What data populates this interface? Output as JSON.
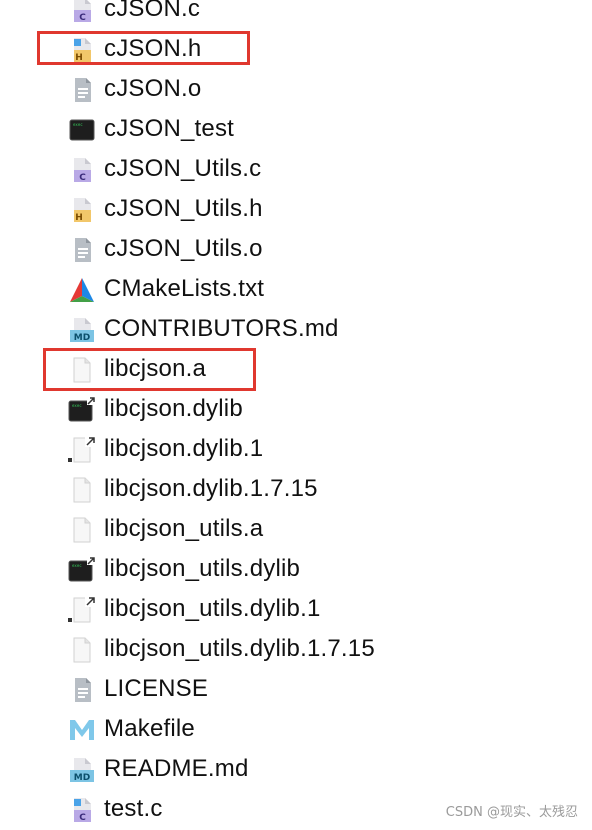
{
  "files": [
    {
      "name": "cJSON.c",
      "icon": "c-source-icon"
    },
    {
      "name": "cJSON.h",
      "icon": "header-file-icon"
    },
    {
      "name": "cJSON.o",
      "icon": "plain-document-icon"
    },
    {
      "name": "cJSON_test",
      "icon": "terminal-executable-icon"
    },
    {
      "name": "cJSON_Utils.c",
      "icon": "c-source-icon"
    },
    {
      "name": "cJSON_Utils.h",
      "icon": "header-file-icon"
    },
    {
      "name": "cJSON_Utils.o",
      "icon": "plain-document-icon"
    },
    {
      "name": "CMakeLists.txt",
      "icon": "cmake-icon"
    },
    {
      "name": "CONTRIBUTORS.md",
      "icon": "markdown-file-icon"
    },
    {
      "name": "libcjson.a",
      "icon": "blank-file-icon"
    },
    {
      "name": "libcjson.dylib",
      "icon": "terminal-alias-icon"
    },
    {
      "name": "libcjson.dylib.1",
      "icon": "blank-alias-icon"
    },
    {
      "name": "libcjson.dylib.1.7.15",
      "icon": "blank-file-icon"
    },
    {
      "name": "libcjson_utils.a",
      "icon": "blank-file-icon"
    },
    {
      "name": "libcjson_utils.dylib",
      "icon": "terminal-alias-icon"
    },
    {
      "name": "libcjson_utils.dylib.1",
      "icon": "blank-alias-icon"
    },
    {
      "name": "libcjson_utils.dylib.1.7.15",
      "icon": "blank-file-icon"
    },
    {
      "name": "LICENSE",
      "icon": "plain-document-icon"
    },
    {
      "name": "Makefile",
      "icon": "makefile-icon"
    },
    {
      "name": "README.md",
      "icon": "markdown-file-icon"
    },
    {
      "name": "test.c",
      "icon": "c-source-icon"
    }
  ],
  "highlighted": [
    "cJSON.h",
    "libcjson.a"
  ],
  "highlight_color": "#e0382f",
  "watermark": "CSDN @现实、太残忍"
}
